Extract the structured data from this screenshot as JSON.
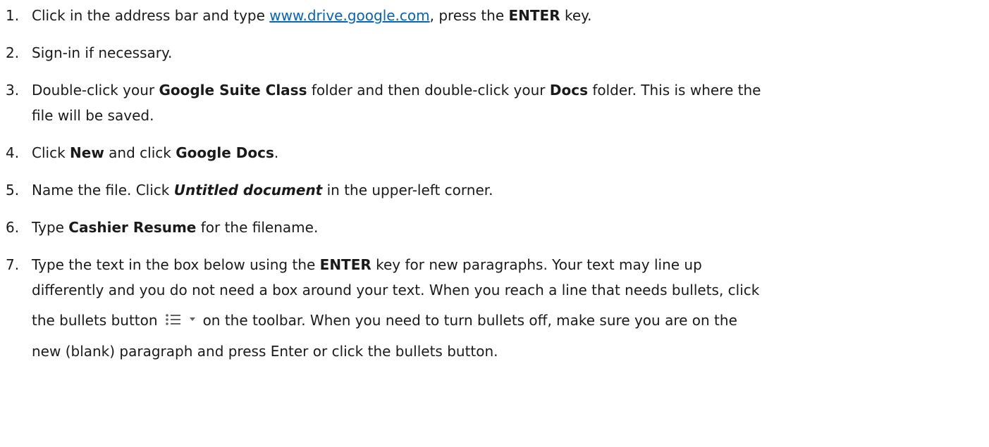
{
  "steps": [
    {
      "num": "1.",
      "pre": "Click in the address bar and type ",
      "link": "www.drive.google.com",
      "mid": ", press the ",
      "b1": "ENTER",
      "post": " key."
    },
    {
      "num": "2.",
      "text": "Sign-in if necessary."
    },
    {
      "num": "3.",
      "pre": "Double-click your ",
      "b1": "Google Suite Class",
      "mid": " folder and then double-click your ",
      "b2": "Docs",
      "post1": " folder. This is where the",
      "line2": "file will be saved."
    },
    {
      "num": "4.",
      "pre": "Click ",
      "b1": "New",
      "mid": " and click ",
      "b2": "Google Docs",
      "post": "."
    },
    {
      "num": "5.",
      "pre": "Name the file. Click ",
      "bi": "Untitled document",
      "post": " in the upper-left corner."
    },
    {
      "num": "6.",
      "pre": "Type ",
      "b1": "Cashier Resume",
      "post": " for the filename."
    },
    {
      "num": "7.",
      "l1_pre": "Type the text in the box below using the ",
      "l1_b": "ENTER",
      "l1_post": " key for new paragraphs. Your text may line up",
      "l2": "differently and you do not need a box around your text. When you reach a line that needs bullets, click",
      "l3_pre": "the bullets button",
      "l3_post": "on the toolbar. When you need to turn bullets off, make sure you are on the",
      "l4": "new (blank) paragraph and press Enter or click the bullets button."
    }
  ],
  "icons": {
    "bullets": "bulleted-list-icon",
    "dropdown": "dropdown-arrow-icon",
    "icon_color": "#5f6368"
  },
  "colors": {
    "link": "#0563c1",
    "text": "#1a1a1a"
  }
}
